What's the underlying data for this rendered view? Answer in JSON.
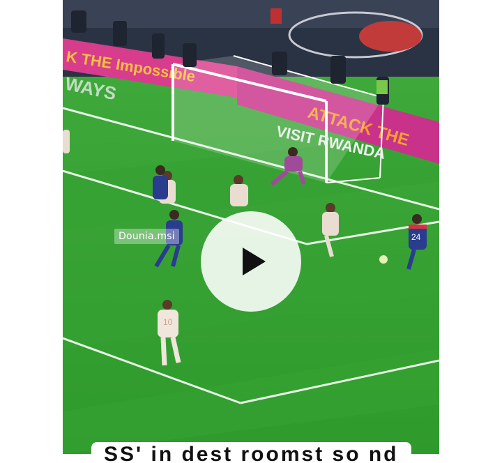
{
  "video": {
    "watermark": "Dounia.msi",
    "caption": "SS' in dest roomst so nd",
    "ad_boards": {
      "left": "K THE Impossible",
      "right": "ATTACK THE",
      "goal_text": "VISIT RWANDA",
      "side": "WAYS"
    },
    "player_numbers": {
      "blue_player": "24",
      "white_player": "10"
    }
  },
  "play_button": {
    "label": "Play"
  },
  "colors": {
    "pitch": "#2e9b2e",
    "ad_board": "#d83c8c",
    "play_circle": "#ffffff"
  }
}
